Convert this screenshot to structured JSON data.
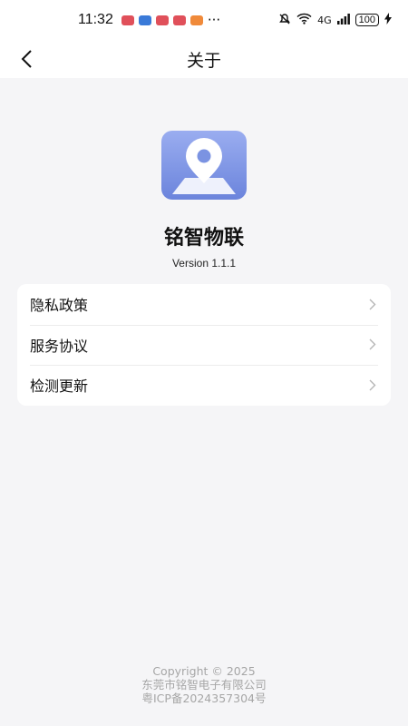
{
  "status_bar": {
    "time": "11:32",
    "overflow": "···",
    "signal_label": "4G",
    "battery": "100",
    "app_icons": [
      "#e0505a",
      "#3a7ad8",
      "#e0505a",
      "#e0505a",
      "#f08a3a"
    ]
  },
  "nav": {
    "title": "关于"
  },
  "app": {
    "name": "铭智物联",
    "version": "Version 1.1.1"
  },
  "menu": [
    {
      "label": "隐私政策"
    },
    {
      "label": "服务协议"
    },
    {
      "label": "检测更新"
    }
  ],
  "footer": {
    "copyright": "Copyright © 2025",
    "company": "东莞市铭智电子有限公司",
    "icp": "粤ICP备2024357304号"
  },
  "colors": {
    "accent": "#6b84dc",
    "background": "#f5f5f7"
  }
}
